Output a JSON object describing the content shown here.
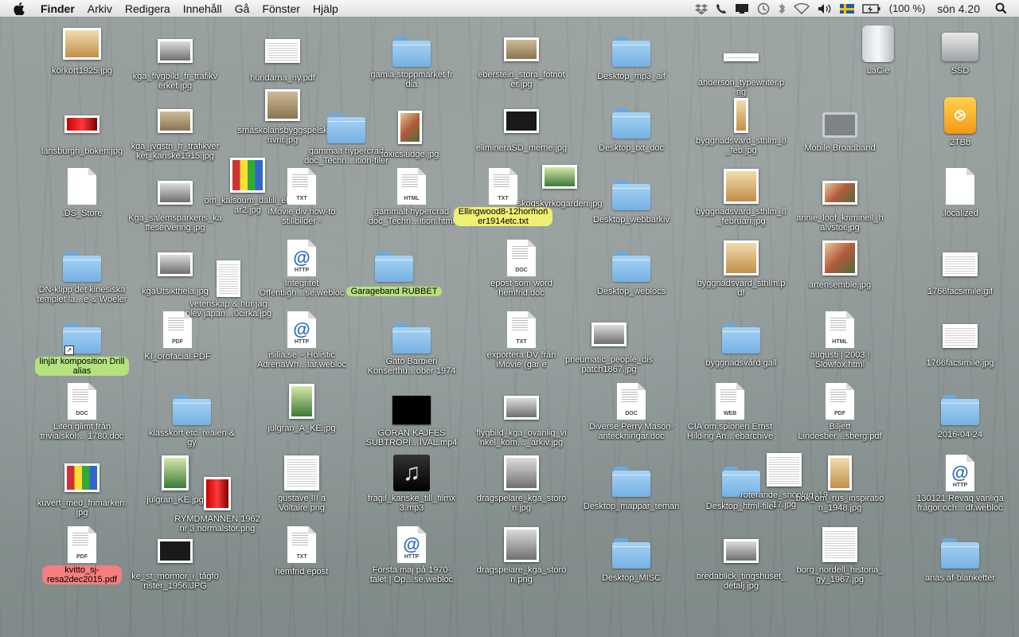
{
  "menubar": {
    "app": "Finder",
    "menus": [
      "Arkiv",
      "Redigera",
      "Innehåll",
      "Gå",
      "Fönster",
      "Hjälp"
    ],
    "status": {
      "battery": "(100 %)",
      "clock": "sön 4.20",
      "icons": [
        "dropbox-icon",
        "phone-icon",
        "display-icon",
        "time-machine-icon",
        "bluetooth-icon",
        "wifi-icon",
        "volume-icon",
        "swedish-flag-icon",
        "battery-icon",
        "spotlight-icon"
      ]
    }
  },
  "desktop": {
    "icons": [
      {
        "label": "körkort1925.jpg",
        "kind": "photo",
        "style": "tan"
      },
      {
        "label": "kga_flygbild_fr_trafikv\nerket.jpg",
        "kind": "photo",
        "style": "bw"
      },
      {
        "label": "hundarna_ny.pdf",
        "kind": "photo",
        "style": "paper"
      },
      {
        "label": "gamla stoppmärket fr\ndia",
        "kind": "folder"
      },
      {
        "label": "eberstein_stora_fotnot\ner.jpg",
        "kind": "photo",
        "style": "sepia"
      },
      {
        "label": "Desktop_mp3_aif",
        "kind": "folder"
      },
      {
        "label": "anderson_typewriter.p\nng",
        "kind": "photo",
        "style": "paper"
      },
      {
        "label": "LaCie",
        "kind": "drive"
      },
      {
        "label": "SSD",
        "kind": "hdd"
      },
      {
        "label": "lansburgh_boken.jpg",
        "kind": "photo",
        "style": "red"
      },
      {
        "label": "kga_jvgstn_fr_trafikver\nket_kanske1915.jpg",
        "kind": "photo",
        "style": "sepia"
      },
      {
        "label": "småskolansbyggspelsk\nrivrit.jpg",
        "kind": "photo",
        "style": "sepia"
      },
      {
        "label": "gammalt hypercrad\ndoc_Techn…ition-filer",
        "kind": "folder"
      },
      {
        "label": "toxicsludge.jpg",
        "kind": "photo",
        "style": "color"
      },
      {
        "label": "elimineraSD_meme.jpg",
        "kind": "photo",
        "style": "dark"
      },
      {
        "label": "Desktop_txt_doc",
        "kind": "folder"
      },
      {
        "label": "byggnadsvard_sthlm_8\n_feb.jpg",
        "kind": "photo",
        "style": "tan"
      },
      {
        "label": "Mobile Broadband",
        "kind": "modem"
      },
      {
        "label": "2TBb",
        "kind": "firewire"
      },
      {
        "label": ".DS_Store",
        "kind": "doc",
        "doc": "blank"
      },
      {
        "label": "Kga_salemsparkens_ka\nffeservering.jpg",
        "kind": "photo",
        "style": "bw"
      },
      {
        "label": "om_kalsoum_dalili_eh\nar2.jpg",
        "kind": "photo",
        "style": "multi"
      },
      {
        "label": "iMovie div how-to\nstillbilder -",
        "kind": "doc",
        "doc": "TXT"
      },
      {
        "label": "gammalt hypercrad\ndoc_Techn…ition.html",
        "kind": "doc",
        "doc": "HTML"
      },
      {
        "label": "Ellingwood8-12hormon\ner1914etc.txt",
        "kind": "doc",
        "doc": "TXT",
        "tag": "yellow"
      },
      {
        "label": "skogskyrkogarden.jpg",
        "kind": "photo",
        "style": "green"
      },
      {
        "label": "Desktop_webbarkiv",
        "kind": "folder"
      },
      {
        "label": "byggnadsvard_sthlm_8\n_februari.jpg",
        "kind": "photo",
        "style": "tan"
      },
      {
        "label": "annie_loof_kriminell_h\nalvstor.jpg",
        "kind": "photo",
        "style": "color"
      },
      {
        "label": ".localized",
        "kind": "doc",
        "doc": "blank"
      },
      {
        "label": "DN-klipp det kinesiska\ntemplet la…e & Woeler",
        "kind": "folder"
      },
      {
        "label": "kgaUtsikthela.jpg",
        "kind": "photo",
        "style": "bw"
      },
      {
        "label": "vetenskap & hur jag\nblev japan…0cirka.jpg",
        "kind": "photo",
        "style": "paper"
      },
      {
        "label": "Integritet\nOffentligh…se.webloc",
        "kind": "doc",
        "doc": "HTTP"
      },
      {
        "label": "Garageband RUBBET",
        "kind": "folder",
        "tag": "green"
      },
      {
        "label": "epost som word\nhemfrid.doc",
        "kind": "doc",
        "doc": "DOC"
      },
      {
        "label": "Desktop_weblocs",
        "kind": "folder"
      },
      {
        "label": "byggnadsvard_sthlm.p\ndf",
        "kind": "photo",
        "style": "tan"
      },
      {
        "label": "artensemble.jpg",
        "kind": "photo",
        "style": "color"
      },
      {
        "label": "1766facsimile.gif",
        "kind": "photo",
        "style": "paper"
      },
      {
        "label": "linjär komposition Drill\nalias",
        "kind": "folder",
        "tag": "green",
        "alias": true
      },
      {
        "label": "KI_orofacial.PDF",
        "kind": "doc",
        "doc": "PDF"
      },
      {
        "label": "isilia.se – Holistic\nAdrenaWh…lar.webloc",
        "kind": "doc",
        "doc": "HTTP"
      },
      {
        "label": "Gato Barbieri\nKonserthu…ober 1974",
        "kind": "folder"
      },
      {
        "label": "exportera DV från\niMovie (gar e",
        "kind": "doc",
        "doc": "TXT"
      },
      {
        "label": "pneumatic_people_dis\npatch1867.jpg",
        "kind": "photo",
        "style": "bw"
      },
      {
        "label": "byggnadsvård gall",
        "kind": "folder"
      },
      {
        "label": "augusti | 2003 |\nSlowfox.html",
        "kind": "doc",
        "doc": "HTML"
      },
      {
        "label": "1766facsimile.jpg",
        "kind": "photo",
        "style": "paper"
      },
      {
        "label": "Liten glimt från\ntrivialskol… 1780.doc",
        "kind": "doc",
        "doc": "DOC"
      },
      {
        "label": "klasskort etc. realen &\ngy",
        "kind": "folder"
      },
      {
        "label": "julgran_A_KE.jpg",
        "kind": "photo",
        "style": "green"
      },
      {
        "label": "GORAN KAJFES\nSUBTROPI…IVAL.mp4",
        "kind": "video"
      },
      {
        "label": "flygbild_kga_ovanlig_vi\nnkel_kom…_arkiv.jpg",
        "kind": "photo",
        "style": "bw"
      },
      {
        "label": "Diverse Perry Mason-\nanteckningar.doc",
        "kind": "doc",
        "doc": "DOC"
      },
      {
        "label": "CIA om spionen Ernst\nHilding An…ebarchive",
        "kind": "doc",
        "doc": "WEB"
      },
      {
        "label": "Biljett\nLindesber…sberg.pdf",
        "kind": "doc",
        "doc": "PDF"
      },
      {
        "label": "2016-04-24",
        "kind": "folder"
      },
      {
        "label": "kuvert_med_frimärken.\njpg",
        "kind": "photo",
        "style": "multi"
      },
      {
        "label": "julgran_KE.jpg",
        "kind": "photo",
        "style": "green"
      },
      {
        "label": "RYMDMANNEN 1962\nnr 3 normalstor.png",
        "kind": "photo",
        "style": "red"
      },
      {
        "label": "gustave III a\nVoltaire.png",
        "kind": "photo",
        "style": "paper"
      },
      {
        "label": "fragil_kanske_till_filmx\n3.mp3",
        "kind": "music"
      },
      {
        "label": "dragspelare_kga_storö\nn.jpg",
        "kind": "photo",
        "style": "bw"
      },
      {
        "label": "Desktop_mappar_teman",
        "kind": "folder"
      },
      {
        "label": "Desktop_html-filer",
        "kind": "folder"
      },
      {
        "label": "roterande_snöplog_19\n17.jpg",
        "kind": "photo",
        "style": "paper"
      },
      {
        "label": "bok_om_rus_inspiratio\nn_1948.jpg",
        "kind": "photo",
        "style": "tan"
      },
      {
        "label": "130121 Revaq vanliga\nfrågor och…df.webloc",
        "kind": "doc",
        "doc": "HTTP"
      },
      {
        "label": "kvitto_sj-\nresa2dec2015.pdf",
        "kind": "doc",
        "doc": "PDF",
        "tag": "red"
      },
      {
        "label": "ke_st_mormor_i_tågfö\nnster_1956.JPG",
        "kind": "photo",
        "style": "dark"
      },
      {
        "label": "hemfrid epost",
        "kind": "doc",
        "doc": "TXT"
      },
      {
        "label": "Första maj på 1970-\ntalet | Op…se.webloc",
        "kind": "doc",
        "doc": "HTTP"
      },
      {
        "label": "dragspelare_kga_storö\nn.png",
        "kind": "photo",
        "style": "bw"
      },
      {
        "label": "Desktop_MISC",
        "kind": "folder"
      },
      {
        "label": "bredablick_tingshuset_\ndetalj.jpg",
        "kind": "photo",
        "style": "bw"
      },
      {
        "label": "borg_nordell_historia_\ngy_1967.jpg",
        "kind": "photo",
        "style": "paper"
      },
      {
        "label": "anas af-blanketter",
        "kind": "folder"
      }
    ]
  }
}
